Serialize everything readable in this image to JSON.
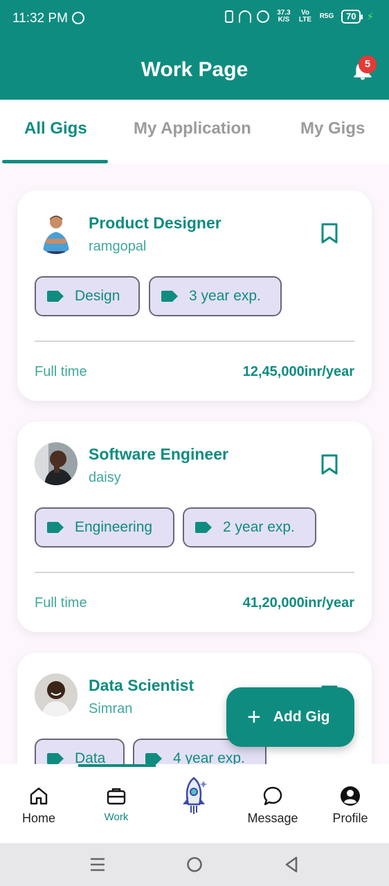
{
  "status_bar": {
    "time": "11:32 PM",
    "speed": "37.3 K/S",
    "network": "R5G",
    "volte": "Vo LTE",
    "battery": "70"
  },
  "app_bar": {
    "title": "Work Page",
    "notification_count": "5"
  },
  "tabs": [
    {
      "label": "All Gigs",
      "active": true
    },
    {
      "label": "My Application",
      "active": false
    },
    {
      "label": "My Gigs",
      "active": false
    }
  ],
  "gigs": [
    {
      "title": "Product Designer",
      "company": "ramgopal",
      "tags": [
        "Design",
        "3 year exp."
      ],
      "job_type": "Full time",
      "salary": "12,45,000inr/year"
    },
    {
      "title": "Software Engineer",
      "company": "daisy",
      "tags": [
        "Engineering",
        "2 year exp."
      ],
      "job_type": "Full time",
      "salary": "41,20,000inr/year"
    },
    {
      "title": "Data Scientist",
      "company": "Simran",
      "tags": [
        "Data",
        "4 year exp."
      ],
      "job_type": "",
      "salary": ""
    }
  ],
  "fab": {
    "label": "Add Gig",
    "icon": "plus-icon"
  },
  "bottom_nav": [
    {
      "label": "Home",
      "icon": "home-icon"
    },
    {
      "label": "Work",
      "icon": "briefcase-icon",
      "active": true
    },
    {
      "label": "",
      "icon": "rocket-icon"
    },
    {
      "label": "Message",
      "icon": "chat-bubble-icon"
    },
    {
      "label": "Profile",
      "icon": "profile-icon"
    }
  ],
  "colors": {
    "primary": "#0f8c80",
    "chip_bg": "#e3e0f6",
    "badge": "#e53935",
    "background": "#fdf7fd"
  }
}
